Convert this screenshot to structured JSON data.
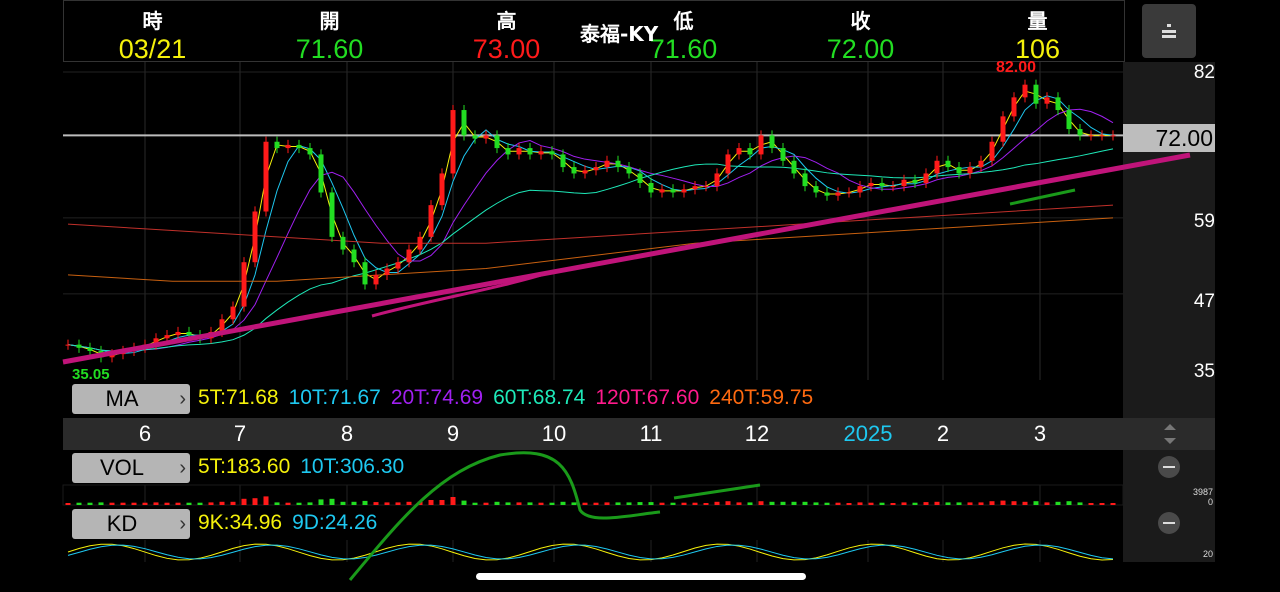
{
  "header": {
    "title": "泰福-KY",
    "columns": [
      {
        "label": "時",
        "value": "03/21",
        "color": "#f5f10b"
      },
      {
        "label": "開",
        "value": "71.60",
        "color": "#22dd22"
      },
      {
        "label": "高",
        "value": "73.00",
        "color": "#ff1a1a"
      },
      {
        "label": "低",
        "value": "71.60",
        "color": "#22dd22"
      },
      {
        "label": "收",
        "value": "72.00",
        "color": "#22dd22"
      },
      {
        "label": "量",
        "value": "106",
        "color": "#f5f10b"
      }
    ],
    "menu_icon": "sort-icon"
  },
  "price_axis": {
    "labels": [
      "82",
      "59",
      "47",
      "35"
    ],
    "last_price": "72.00",
    "high_marker": "82.00",
    "low_marker": "35.05"
  },
  "ma_row": {
    "button": "MA",
    "items": [
      {
        "text": "5T:71.68",
        "color": "#f5f10b"
      },
      {
        "text": "10T:71.67",
        "color": "#1ec8f0"
      },
      {
        "text": "20T:74.69",
        "color": "#a020f0"
      },
      {
        "text": "60T:68.74",
        "color": "#1ee8b8"
      },
      {
        "text": "120T:67.60",
        "color": "#ff1a8c"
      },
      {
        "text": "240T:59.75",
        "color": "#ff6a10"
      }
    ]
  },
  "months": [
    {
      "label": "6",
      "color": "#ffffff"
    },
    {
      "label": "7",
      "color": "#ffffff"
    },
    {
      "label": "8",
      "color": "#ffffff"
    },
    {
      "label": "9",
      "color": "#ffffff"
    },
    {
      "label": "10",
      "color": "#ffffff"
    },
    {
      "label": "11",
      "color": "#ffffff"
    },
    {
      "label": "12",
      "color": "#ffffff"
    },
    {
      "label": "2025",
      "color": "#1ec8f0"
    },
    {
      "label": "2",
      "color": "#ffffff"
    },
    {
      "label": "3",
      "color": "#ffffff"
    }
  ],
  "vol_row": {
    "button": "VOL",
    "items": [
      {
        "text": "5T:183.60",
        "color": "#f5f10b"
      },
      {
        "text": "10T:306.30",
        "color": "#1ec8f0"
      }
    ],
    "axis_max": "3987",
    "axis_min": "0"
  },
  "kd_row": {
    "button": "KD",
    "items": [
      {
        "text": "9K:34.96",
        "color": "#f5f10b"
      },
      {
        "text": "9D:24.26",
        "color": "#1ec8f0"
      }
    ],
    "axis": "20"
  },
  "chart_data": {
    "type": "candlestick",
    "ylim": [
      35,
      82
    ],
    "closes": [
      39,
      38.5,
      38,
      37,
      37.5,
      38,
      38.5,
      39,
      40,
      40.5,
      41,
      40.5,
      40,
      41,
      43,
      45,
      52,
      60,
      71,
      70,
      70.5,
      70,
      69,
      63,
      56,
      54,
      52,
      48.5,
      50,
      51,
      52,
      54,
      56,
      61,
      66,
      76,
      72,
      71.5,
      72,
      70,
      69,
      70,
      69,
      69.5,
      69,
      67,
      66,
      66.5,
      67,
      68,
      67,
      66,
      64.5,
      63,
      63.5,
      63,
      63.5,
      64,
      64,
      66,
      69,
      70,
      69,
      72,
      70,
      68,
      66,
      64,
      63,
      62.5,
      63,
      63,
      64,
      64.5,
      64,
      64,
      65,
      64.5,
      66,
      68,
      67,
      66,
      67,
      68,
      71,
      75,
      78,
      80,
      77,
      78,
      76,
      73,
      72,
      72,
      72,
      72
    ],
    "up_color": "#ff1a1a",
    "down_color": "#22dd22"
  }
}
